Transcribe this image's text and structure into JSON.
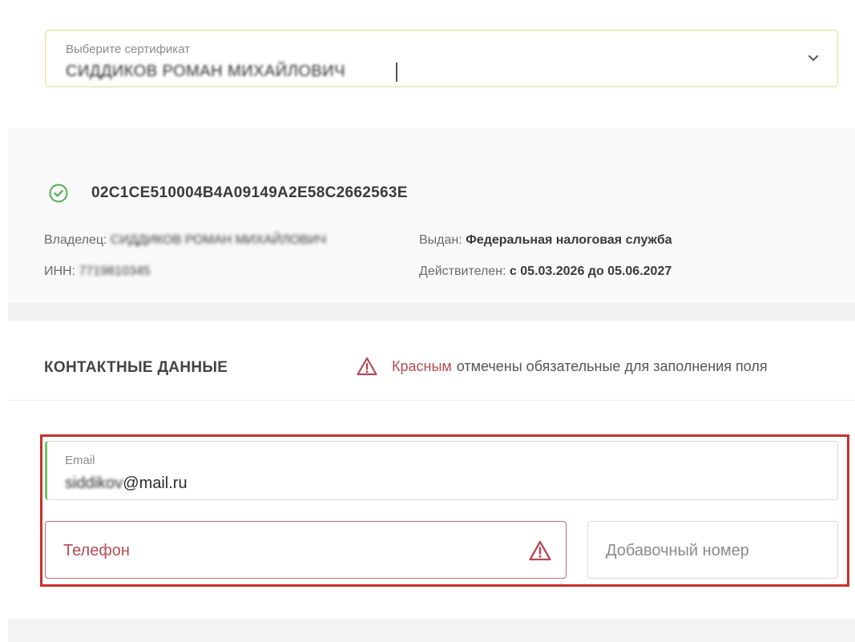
{
  "certificate_select": {
    "label": "Выберите сертификат",
    "value": "СИДДИКОВ РОМАН МИХАЙЛОВИЧ"
  },
  "certificate": {
    "id": "02C1CE510004B4A09149A2E58C2662563E",
    "owner_label": "Владелец:",
    "owner_value": "СИДДИКОВ РОМАН МИХАЙЛОВИЧ",
    "inn_label": "ИНН:",
    "inn_value": "7719810345",
    "issuer_label": "Выдан:",
    "issuer_value": "Федеральная налоговая служба",
    "valid_label": "Действителен:",
    "valid_value": "с 05.03.2026 до 05.06.2027"
  },
  "contacts": {
    "title": "КОНТАКТНЫЕ ДАННЫЕ",
    "note_highlight": "Красным",
    "note_rest": "отмечены обязательные для заполнения поля"
  },
  "email": {
    "label": "Email",
    "value_hidden": "siddikov",
    "value_domain": "@mail.ru"
  },
  "phone": {
    "placeholder": "Телефон"
  },
  "extension": {
    "placeholder": "Добавочный номер"
  },
  "colors": {
    "accent_green": "#6fc46a",
    "error_red": "#b54a55",
    "frame_red": "#c8302f"
  }
}
